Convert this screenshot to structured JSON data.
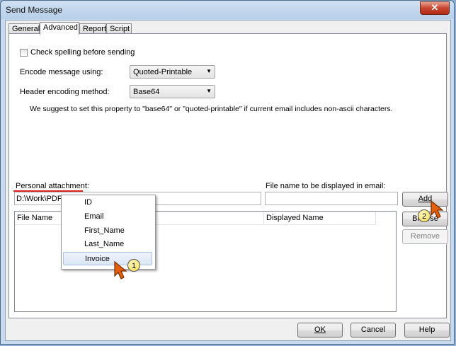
{
  "window": {
    "title": "Send Message",
    "close_glyph": "✕"
  },
  "tabs": [
    {
      "label": "General"
    },
    {
      "label": "Advanced"
    },
    {
      "label": "Report"
    },
    {
      "label": "Script"
    }
  ],
  "advanced": {
    "spellcheck_label": "Check spelling before sending",
    "encode_label": "Encode message using:",
    "encode_value": "Quoted-Printable",
    "header_label": "Header encoding method:",
    "header_value": "Base64",
    "hint": "We suggest to set this property to \"base64\" or \"quoted-printable\"  if current email includes non-ascii characters.",
    "attachment_label": "Personal attachment:",
    "attachment_value": "D:\\Work\\PDF\\",
    "display_name_label": "File name to be displayed in email:",
    "display_name_value": "",
    "columns": [
      "File Name",
      "Displayed Name"
    ],
    "add_button": "Add",
    "browse_button": "Browse",
    "remove_button": "Remove"
  },
  "popup": {
    "items": [
      "ID",
      "Email",
      "First_Name",
      "Last_Name",
      "Invoice"
    ],
    "selected": "Invoice"
  },
  "annotations": {
    "badge1": "1",
    "badge2": "2"
  },
  "footer": {
    "ok": "OK",
    "cancel": "Cancel",
    "help": "Help"
  },
  "colors": {
    "window_frame": "#c9daec",
    "selection": "#dae6f5",
    "annotation_underline": "#d22222",
    "cursor": "#e0600f"
  },
  "icons": [
    "close-icon",
    "chevron-down-icon",
    "cursor-icon"
  ]
}
